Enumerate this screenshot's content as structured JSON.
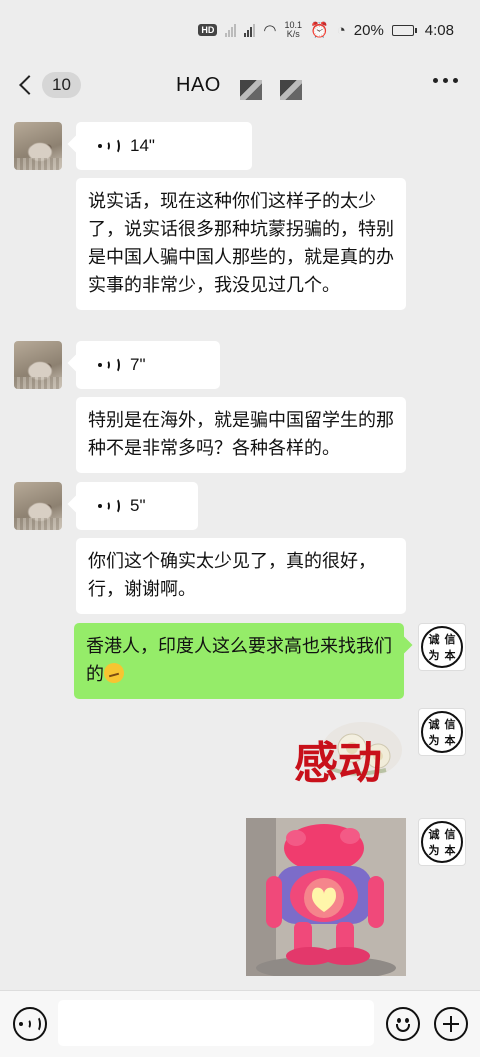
{
  "status": {
    "network_badge": "HD",
    "speed_top": "10.1",
    "speed_unit": "K/s",
    "battery": "20%",
    "battery_level": 0.2,
    "time": "4:08"
  },
  "header": {
    "back_count": "10",
    "title": "HAO"
  },
  "messages": [
    {
      "type": "voice",
      "side": "left",
      "duration": "14\""
    },
    {
      "type": "text",
      "side": "left",
      "text": "说实话，现在这种你们这样子的太少了，说实话很多那种坑蒙拐骗的，特别是中国人骗中国人那些的，就是真的办实事的非常少，我没见过几个。"
    },
    {
      "type": "voice",
      "side": "left",
      "duration": "7\""
    },
    {
      "type": "text",
      "side": "left",
      "text": "特别是在海外，就是骗中国留学生的那种不是非常多吗？各种各样的。"
    },
    {
      "type": "voice",
      "side": "left",
      "duration": "5\""
    },
    {
      "type": "text",
      "side": "left",
      "text": "你们这个确实太少见了，真的很好，行，谢谢啊。"
    },
    {
      "type": "text",
      "side": "right",
      "text": "香港人，印度人这么要求高也来找我们的"
    },
    {
      "type": "sticker",
      "side": "right",
      "text": "感动"
    },
    {
      "type": "image",
      "side": "right"
    }
  ],
  "seal_chars": [
    "诚",
    "信",
    "为",
    "本"
  ],
  "input": {
    "value": "",
    "placeholder": ""
  }
}
